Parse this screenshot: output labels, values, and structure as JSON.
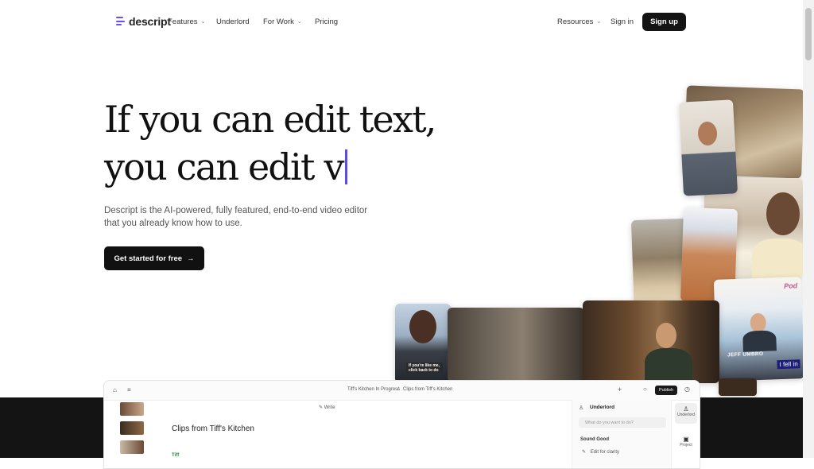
{
  "nav": {
    "logo_text": "descript",
    "items": [
      {
        "label": "Features",
        "has_dropdown": true
      },
      {
        "label": "Underlord",
        "has_dropdown": false
      },
      {
        "label": "For Work",
        "has_dropdown": true
      },
      {
        "label": "Pricing",
        "has_dropdown": false
      }
    ],
    "resources_label": "Resources",
    "signin_label": "Sign in",
    "signup_label": "Sign up"
  },
  "hero": {
    "headline_line1": "If you can edit text,",
    "headline_line2": "you can edit v",
    "subtitle": "Descript is the AI-powered, fully featured, end-to-end video editor that you already know how to use.",
    "cta_label": "Get started for free",
    "cta_arrow": "→",
    "accent_color": "#5a4ce0"
  },
  "collage": {
    "caption_boy": "If you're like me, click back to do",
    "caption_jeff_name": "JEFF UMBRO",
    "caption_jeff_text": "I fell in",
    "corner_logo": "Pod"
  },
  "app_preview": {
    "breadcrumb_project": "Tiff's Kitchen In Progress",
    "breadcrumb_sep": "/",
    "breadcrumb_file": "Clips from Tiff's Kitchen",
    "write_label": "Write",
    "publish_label": "Publish",
    "panel_title": "Underlord",
    "ask_placeholder": "What do you want to do?",
    "section_label": "Sound Good",
    "action_label": "Edit for clarity",
    "doc_title": "Clips from Tiff's Kitchen",
    "speaker": "Tiff",
    "rail_underlord": "Underlord",
    "rail_project": "Project"
  }
}
